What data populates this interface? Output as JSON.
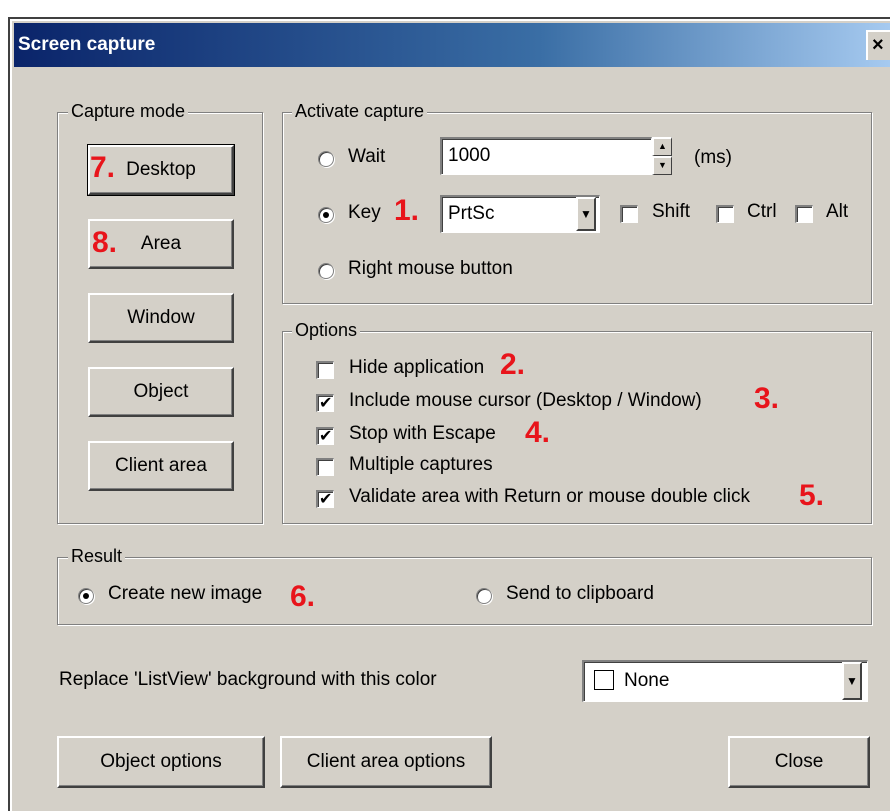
{
  "window": {
    "title": "Screen capture",
    "close_glyph": "×"
  },
  "capture_mode": {
    "legend": "Capture mode",
    "buttons": [
      "Desktop",
      "Area",
      "Window",
      "Object",
      "Client area"
    ]
  },
  "activate_capture": {
    "legend": "Activate capture",
    "wait_label": "Wait",
    "wait_value": "1000",
    "wait_unit": "(ms)",
    "key_label": "Key",
    "key_value": "PrtSc",
    "shift_label": "Shift",
    "ctrl_label": "Ctrl",
    "alt_label": "Alt",
    "right_mouse_label": "Right mouse button",
    "selected": "Key"
  },
  "options": {
    "legend": "Options",
    "items": [
      {
        "label": "Hide application",
        "checked": false
      },
      {
        "label": "Include mouse cursor (Desktop / Window)",
        "checked": true
      },
      {
        "label": "Stop with Escape",
        "checked": true
      },
      {
        "label": "Multiple captures",
        "checked": false
      },
      {
        "label": "Validate area with Return or mouse double click",
        "checked": true
      }
    ]
  },
  "result": {
    "legend": "Result",
    "create_new_label": "Create new image",
    "clipboard_label": "Send to clipboard",
    "selected": "Create new image"
  },
  "listview": {
    "label": "Replace 'ListView' background with this color",
    "value": "None"
  },
  "footer": {
    "object_options": "Object options",
    "client_area_options": "Client area options",
    "close": "Close"
  },
  "annotations": {
    "n1": "1.",
    "n2": "2.",
    "n3": "3.",
    "n4": "4.",
    "n5": "5.",
    "n6": "6.",
    "n7": "7.",
    "n8": "8."
  },
  "colors": {
    "face": "#d4d0c8",
    "title_start": "#0a246a",
    "title_end": "#a6caf0",
    "annotation": "#e8141b"
  }
}
